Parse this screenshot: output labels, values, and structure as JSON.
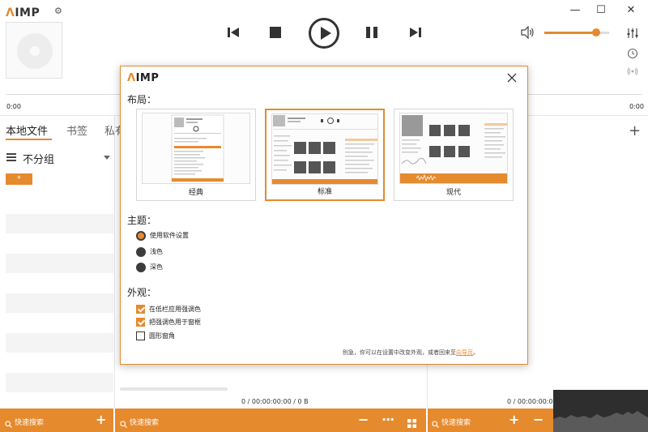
{
  "app": {
    "logo_mark": "Λ",
    "logo_text": "IMP",
    "accent_color": "#e68a2e"
  },
  "window_controls": {
    "minimize": "—",
    "maximize": "☐",
    "close": "✕"
  },
  "player": {
    "time_elapsed": "0:00",
    "time_remaining": "0:00",
    "volume": 0.8
  },
  "library": {
    "tabs": [
      {
        "label": "本地文件",
        "active": true
      },
      {
        "label": "书签",
        "active": false
      },
      {
        "label": "私有",
        "active": false
      }
    ],
    "group_label": "不分组",
    "filter_chip": "*"
  },
  "status": {
    "middle": "0 / 00:00:00:00 / 0 B",
    "right": "0 / 00:00:00:00"
  },
  "bottom_bar": {
    "search_placeholder": "快速搜索"
  },
  "dialog": {
    "logo_mark": "Λ",
    "logo_text": "IMP",
    "sections": {
      "layout": "布局：",
      "theme": "主题：",
      "appearance": "外观："
    },
    "layouts": [
      {
        "label": "经典",
        "selected": false
      },
      {
        "label": "标准",
        "selected": true
      },
      {
        "label": "现代",
        "selected": false
      }
    ],
    "themes": [
      {
        "label": "使用软件设置",
        "selected": true
      },
      {
        "label": "浅色",
        "selected": false
      },
      {
        "label": "深色",
        "selected": false
      }
    ],
    "appearance_options": [
      {
        "label": "在低栏应用强调色",
        "checked": true
      },
      {
        "label": "把强调色用于窗框",
        "checked": true
      },
      {
        "label": "圆形窗角",
        "checked": false
      }
    ],
    "footer_text": "别急，你可以在设置中改变外观，或者回来至",
    "footer_link": "向导页",
    "footer_end": "。"
  }
}
